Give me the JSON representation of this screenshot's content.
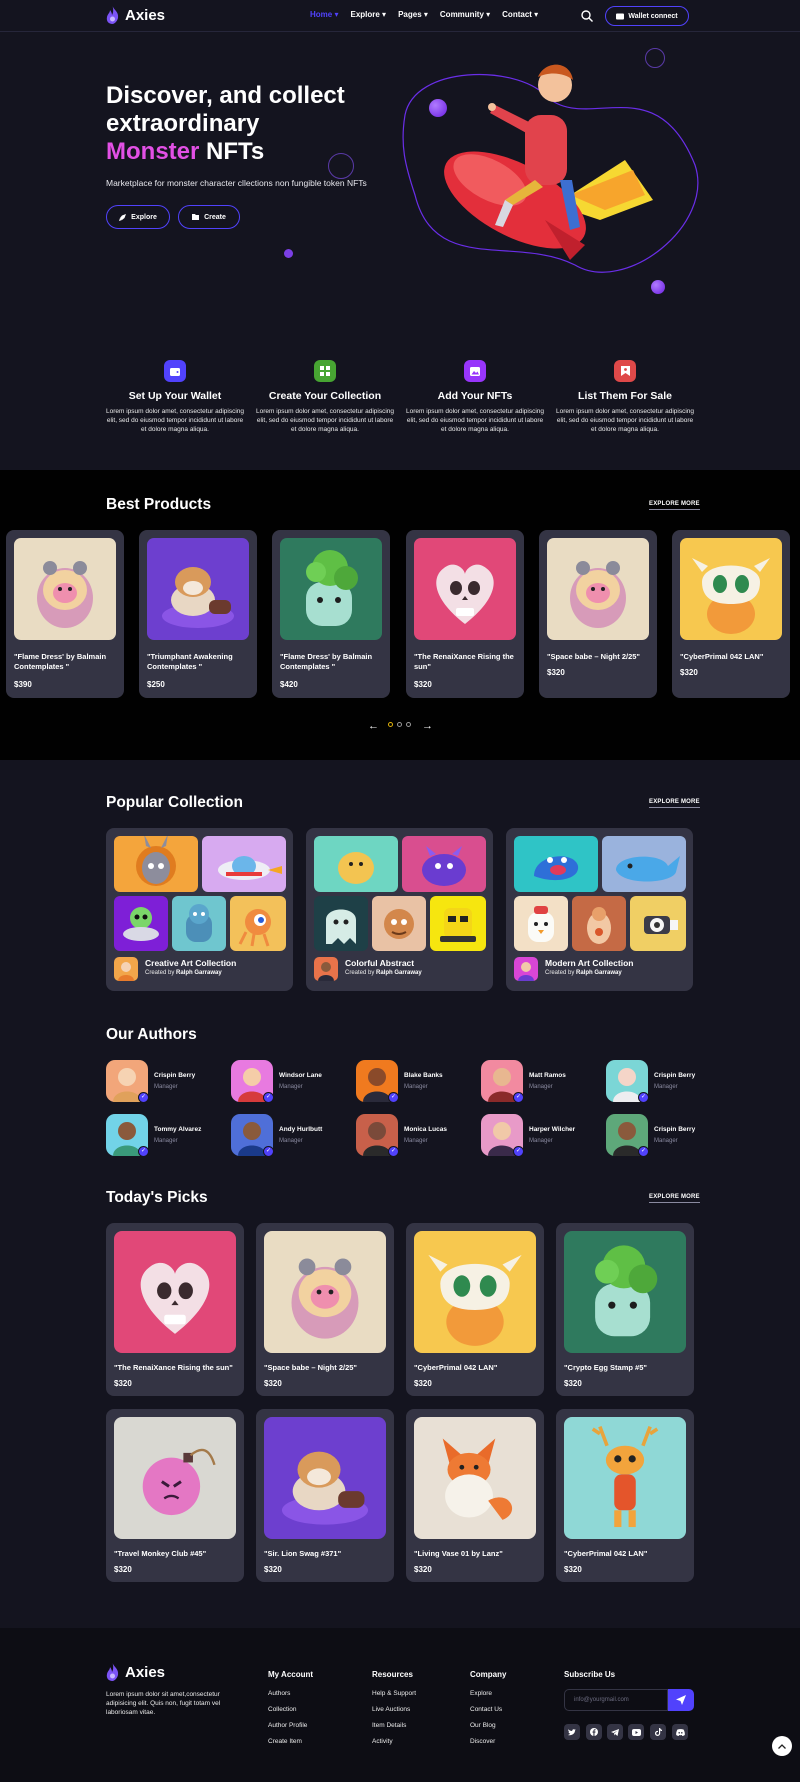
{
  "header": {
    "logo": "Axies",
    "nav": [
      "Home",
      "Explore",
      "Pages",
      "Community",
      "Contact"
    ],
    "wallet_button": "Wallet connect"
  },
  "hero": {
    "title_line1": "Discover, and collect",
    "title_line2": "extraordinary",
    "title_highlight": "Monster",
    "title_rest": "NFTs",
    "subtitle": "Marketplace for monster character cllections non fungible token NFTs",
    "explore_button": "Explore",
    "create_button": "Create"
  },
  "steps": [
    {
      "title": "Set Up Your Wallet",
      "text": "Lorem ipsum dolor amet, consectetur adipiscing elit, sed do eiusmod tempor incididunt ut labore et dolore magna aliqua.",
      "color": "#5142fc"
    },
    {
      "title": "Create Your Collection",
      "text": "Lorem ipsum dolor amet, consectetur adipiscing elit, sed do eiusmod tempor incididunt ut labore et dolore magna aliqua.",
      "color": "#47a432"
    },
    {
      "title": "Add Your NFTs",
      "text": "Lorem ipsum dolor amet, consectetur adipiscing elit, sed do eiusmod tempor incididunt ut labore et dolore magna aliqua.",
      "color": "#9835fb"
    },
    {
      "title": "List Them For Sale",
      "text": "Lorem ipsum dolor amet, consectetur adipiscing elit, sed do eiusmod tempor incididunt ut labore et dolore magna aliqua.",
      "color": "#df4949"
    }
  ],
  "best_products": {
    "title": "Best Products",
    "explore_more": "EXPLORE MORE",
    "items": [
      {
        "name": "\"Flame Dress' by Balmain Contemplates \"",
        "price": "$390"
      },
      {
        "name": "\"Triumphant Awakening Contemplates \"",
        "price": "$250"
      },
      {
        "name": "\"Flame Dress' by Balmain Contemplates \"",
        "price": "$420"
      },
      {
        "name": "\"The RenaiXance Rising the sun\"",
        "price": "$320"
      },
      {
        "name": "\"Space babe – Night 2/25\"",
        "price": "$320"
      },
      {
        "name": "\"CyberPrimal 042 LAN\"",
        "price": "$320"
      }
    ]
  },
  "collections": {
    "title": "Popular Collection",
    "explore_more": "EXPLORE MORE",
    "created_by_prefix": "Created by",
    "items": [
      {
        "name": "Creative Art Collection",
        "author": "Ralph Garraway"
      },
      {
        "name": "Colorful Abstract",
        "author": "Ralph Garraway"
      },
      {
        "name": "Modern Art Collection",
        "author": "Ralph Garraway"
      }
    ]
  },
  "authors": {
    "title": "Our Authors",
    "role": "Manager",
    "items": [
      {
        "name": "Crispin Berry"
      },
      {
        "name": "Windsor Lane"
      },
      {
        "name": "Blake Banks"
      },
      {
        "name": "Matt Ramos"
      },
      {
        "name": "Crispin Berry"
      },
      {
        "name": "Tommy Alvarez"
      },
      {
        "name": "Andy Hurlbutt"
      },
      {
        "name": "Monica Lucas"
      },
      {
        "name": "Harper Wilcher"
      },
      {
        "name": "Crispin Berry"
      }
    ]
  },
  "picks": {
    "title": "Today's Picks",
    "explore_more": "EXPLORE MORE",
    "items": [
      {
        "name": "\"The RenaiXance Rising the sun\"",
        "price": "$320"
      },
      {
        "name": "\"Space babe – Night 2/25\"",
        "price": "$320"
      },
      {
        "name": "\"CyberPrimal 042 LAN\"",
        "price": "$320"
      },
      {
        "name": "\"Crypto Egg Stamp #5\"",
        "price": "$320"
      },
      {
        "name": "\"Travel Monkey Club #45\"",
        "price": "$320"
      },
      {
        "name": "\"Sir. Lion Swag #371\"",
        "price": "$320"
      },
      {
        "name": "\"Living Vase 01 by Lanz\"",
        "price": "$320"
      },
      {
        "name": "\"CyberPrimal 042 LAN\"",
        "price": "$320"
      }
    ]
  },
  "footer": {
    "logo": "Axies",
    "about": "Lorem ipsum dolor sit amet,consectetur adipisicing elit. Quis non, fugit totam vel laboriosam vitae.",
    "account_title": "My Account",
    "account_links": [
      "Authors",
      "Collection",
      "Author Profile",
      "Create Item"
    ],
    "resources_title": "Resources",
    "resources_links": [
      "Help & Support",
      "Live Auctions",
      "Item Details",
      "Activity"
    ],
    "company_title": "Company",
    "company_links": [
      "Explore",
      "Contact Us",
      "Our Blog",
      "Discover"
    ],
    "subscribe_title": "Subscribe Us",
    "email_placeholder": "info@yourgmail.com"
  },
  "colors": {
    "accent": "#5142fc",
    "highlight": "#e250e5",
    "card": "#343444",
    "bg": "#14141f"
  }
}
